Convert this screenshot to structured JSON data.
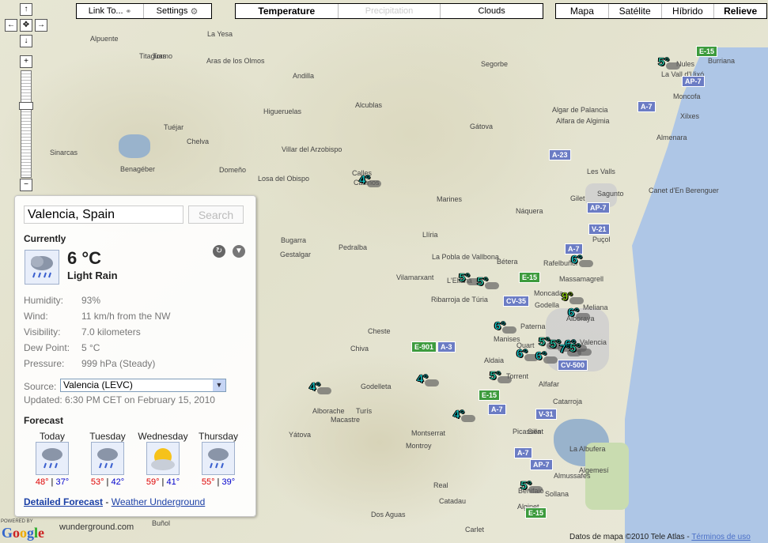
{
  "top_controls": {
    "link_to": "Link To...",
    "settings": "Settings",
    "layers": [
      "Temperature",
      "Precipitation",
      "Clouds"
    ],
    "map_types": [
      "Mapa",
      "Satélite",
      "Híbrido",
      "Relieve"
    ]
  },
  "places": [
    "La Yesa",
    "Tuéjar",
    "Chelva",
    "Benagéber",
    "Alpuente",
    "Tormo",
    "Titaguas",
    "Aras de los Olmos",
    "Andilla",
    "Alcublas",
    "Higueruelas",
    "Sinarcas",
    "Domeño",
    "Calles",
    "Villar del Arzobispo",
    "Losa del Obispo",
    "Casinos",
    "Bugarra",
    "Gestalgar",
    "Pedralba",
    "Chiva",
    "Cheste",
    "Llíria",
    "Marines",
    "Náquera",
    "Segorbe",
    "Gátova",
    "Sagunto",
    "Puçol",
    "Massamagrell",
    "Burriana",
    "Nules",
    "La Vall d'Uixó",
    "Moncofa",
    "Almenara",
    "Canet d'En Berenguer",
    "Valencia",
    "Manises",
    "Aldaia",
    "Torrent",
    "Alfafar",
    "Catarroja",
    "Picassent",
    "Silla",
    "Montserrat",
    "Godelleta",
    "Alborache",
    "Yátova",
    "Macastre",
    "Turís",
    "Montroy",
    "Real",
    "Benifaió",
    "Sollana",
    "Almussafes",
    "Algemesí",
    "Alginet",
    "Carlet",
    "Buñol",
    "Catadau",
    "Dos Aguas",
    "Bétera",
    "Moncada",
    "Godella",
    "Paterna",
    "Meliana",
    "Alboraya",
    "Rafelbuñol",
    "Ribarroja de Túria",
    "Vilamarxant",
    "La Pobla de Vallbona",
    "L'Eliana",
    "Quart",
    "La Albufera",
    "Algar de Palancia",
    "Alfara de Algimia",
    "Gilet",
    "Xilxes",
    "Les Valls"
  ],
  "highways": [
    "E-15",
    "AP-7",
    "A-7",
    "A-23",
    "AP-7",
    "V-21",
    "A-7",
    "E-15",
    "CV-35",
    "E-901",
    "A-3",
    "CV-500",
    "E-15",
    "A-7",
    "V-31",
    "A-7",
    "AP-7",
    "E-15"
  ],
  "temperatures": [
    "5°",
    "4°",
    "6°",
    "5°",
    "5°",
    "9°",
    "6°",
    "6°",
    "5°",
    "5°",
    "6°",
    "6°",
    "5°",
    "6°",
    "7°",
    "5°",
    "4°",
    "4°",
    "4°",
    "5°"
  ],
  "weather": {
    "search_value": "Valencia, Spain",
    "search_button": "Search",
    "currently_label": "Currently",
    "temp": "6 °C",
    "condition": "Light Rain",
    "details": [
      {
        "key": "Humidity:",
        "value": "93%"
      },
      {
        "key": "Wind:",
        "value": "11 km/h from the NW"
      },
      {
        "key": "Visibility:",
        "value": "7.0 kilometers"
      },
      {
        "key": "Dew Point:",
        "value": "5 °C"
      },
      {
        "key": "Pressure:",
        "value": "999 hPa (Steady)"
      }
    ],
    "source_label": "Source:",
    "source_value": "Valencia (LEVC)",
    "updated": "Updated: 6:30 PM CET on February 15, 2010",
    "forecast_label": "Forecast",
    "forecast": [
      {
        "day": "Today",
        "hi": "48°",
        "lo": "37°",
        "icon": "rain-icon"
      },
      {
        "day": "Tuesday",
        "hi": "53°",
        "lo": "42°",
        "icon": "rain-icon"
      },
      {
        "day": "Wednesday",
        "hi": "59°",
        "lo": "41°",
        "icon": "partly-cloudy-icon"
      },
      {
        "day": "Thursday",
        "hi": "55°",
        "lo": "39°",
        "icon": "rain-icon"
      }
    ],
    "detailed_forecast": "Detailed Forecast",
    "separator": "-",
    "weather_underground": "Weather Underground"
  },
  "footer": {
    "powered_by": "POWERED BY",
    "google": "Google",
    "wu": "wunderground.com",
    "copyright": "Datos de mapa ©2010 Tele Atlas -",
    "terms": "Términos de uso"
  }
}
